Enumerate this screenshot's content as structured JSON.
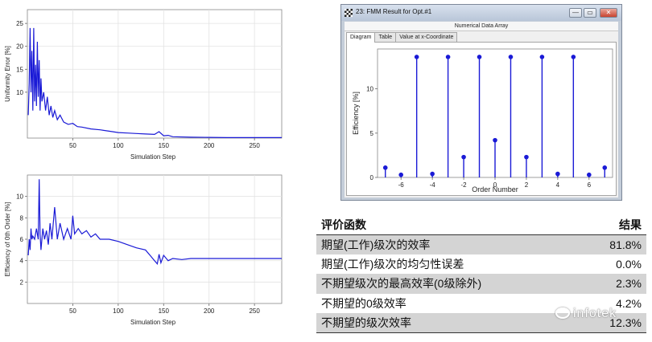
{
  "chart_data": [
    {
      "type": "line",
      "xlabel": "Simulation Step",
      "ylabel": "Uniformity Error [%]",
      "xlim": [
        0,
        280
      ],
      "ylim": [
        0,
        28
      ],
      "xticks": [
        50,
        100,
        150,
        200,
        250
      ],
      "yticks": [
        10,
        15,
        20,
        25
      ],
      "grid": true,
      "series": [
        {
          "color": "#1a1ad6",
          "x": [
            1,
            2,
            3,
            4,
            5,
            6,
            7,
            8,
            9,
            10,
            11,
            12,
            13,
            14,
            15,
            16,
            18,
            20,
            22,
            24,
            26,
            28,
            30,
            33,
            36,
            40,
            45,
            50,
            55,
            60,
            70,
            80,
            90,
            100,
            110,
            120,
            130,
            140,
            145,
            150,
            155,
            160,
            180,
            200,
            220,
            240,
            260,
            280
          ],
          "y": [
            5,
            12,
            24,
            10,
            19,
            6,
            24,
            8,
            16,
            7,
            21,
            9,
            17,
            6,
            13,
            8,
            10,
            6,
            9,
            5,
            7,
            4.5,
            6,
            4,
            5,
            3.5,
            3,
            3.2,
            2.5,
            2.4,
            2,
            1.8,
            1.5,
            1.2,
            1.1,
            1,
            0.9,
            0.8,
            1.4,
            0.5,
            0.6,
            0.3,
            0.2,
            0.15,
            0.1,
            0.1,
            0.1,
            0.1
          ]
        }
      ]
    },
    {
      "type": "line",
      "xlabel": "Simulation Step",
      "ylabel": "Efficiency of 0th Order [%]",
      "xlim": [
        0,
        280
      ],
      "ylim": [
        0,
        12
      ],
      "xticks": [
        50,
        100,
        150,
        200,
        250
      ],
      "yticks": [
        2,
        4,
        6,
        8,
        10
      ],
      "grid": true,
      "series": [
        {
          "color": "#1a1ad6",
          "x": [
            1,
            2,
            3,
            4,
            5,
            6,
            8,
            10,
            12,
            13,
            14,
            15,
            17,
            19,
            21,
            23,
            25,
            27,
            30,
            33,
            36,
            40,
            44,
            48,
            50,
            52,
            56,
            60,
            65,
            70,
            75,
            80,
            90,
            100,
            110,
            120,
            130,
            135,
            140,
            143,
            145,
            147,
            150,
            155,
            160,
            170,
            180,
            200,
            220,
            240,
            260,
            280
          ],
          "y": [
            4.5,
            6,
            5,
            7,
            6,
            6.3,
            6,
            7,
            6,
            11.6,
            6.5,
            5,
            7,
            6,
            6.8,
            5.5,
            7.5,
            6,
            9,
            6,
            7.5,
            6,
            7,
            6,
            8.2,
            6.5,
            7,
            6.5,
            6.8,
            6.2,
            6.5,
            6,
            6,
            5.8,
            5.5,
            5.2,
            5,
            4.5,
            4,
            3.7,
            4.6,
            3.8,
            4.5,
            4,
            4.2,
            4.1,
            4.2,
            4.2,
            4.2,
            4.2,
            4.2,
            4.2
          ]
        }
      ]
    },
    {
      "type": "scatter",
      "subtype": "stem",
      "xlabel": "Order Number",
      "ylabel": "Efficiency [%]",
      "xlim": [
        -7.5,
        7.5
      ],
      "ylim": [
        0,
        14.5
      ],
      "xticks": [
        -6,
        -4,
        -2,
        0,
        2,
        4,
        6
      ],
      "yticks": [
        0,
        5,
        10
      ],
      "grid": false,
      "series": [
        {
          "color": "#1a1ad6",
          "x": [
            -7,
            -6,
            -5,
            -4,
            -3,
            -2,
            -1,
            0,
            1,
            2,
            3,
            4,
            5,
            6,
            7
          ],
          "y": [
            1.1,
            0.3,
            13.6,
            0.4,
            13.6,
            2.3,
            13.6,
            4.2,
            13.6,
            2.3,
            13.6,
            0.4,
            13.6,
            0.3,
            1.1
          ]
        }
      ]
    }
  ],
  "fmm_window": {
    "title": "23: FMM Result for Opt.#1",
    "section_label": "Numerical Data Array",
    "tabs": [
      "Diagram",
      "Table",
      "Value at x-Coordinate"
    ],
    "active_tab": "Diagram",
    "buttons": {
      "minimize": "—",
      "restore": "▭",
      "close": "✕"
    }
  },
  "results_table": {
    "header": {
      "name": "评价函数",
      "value": "结果"
    },
    "rows": [
      {
        "name": "期望(工作)级次的效率",
        "value": "81.8%"
      },
      {
        "name": "期望(工作)级次的均匀性误差",
        "value": "0.0%"
      },
      {
        "name": "不期望级次的最高效率(0级除外)",
        "value": "2.3%"
      },
      {
        "name": "不期望的0级效率",
        "value": "4.2%"
      },
      {
        "name": "不期望的级次效率",
        "value": "12.3%"
      }
    ]
  },
  "watermark": "infotek",
  "icons": {
    "title": "checkered-flag-icon",
    "watermark": "wechat-icon"
  }
}
